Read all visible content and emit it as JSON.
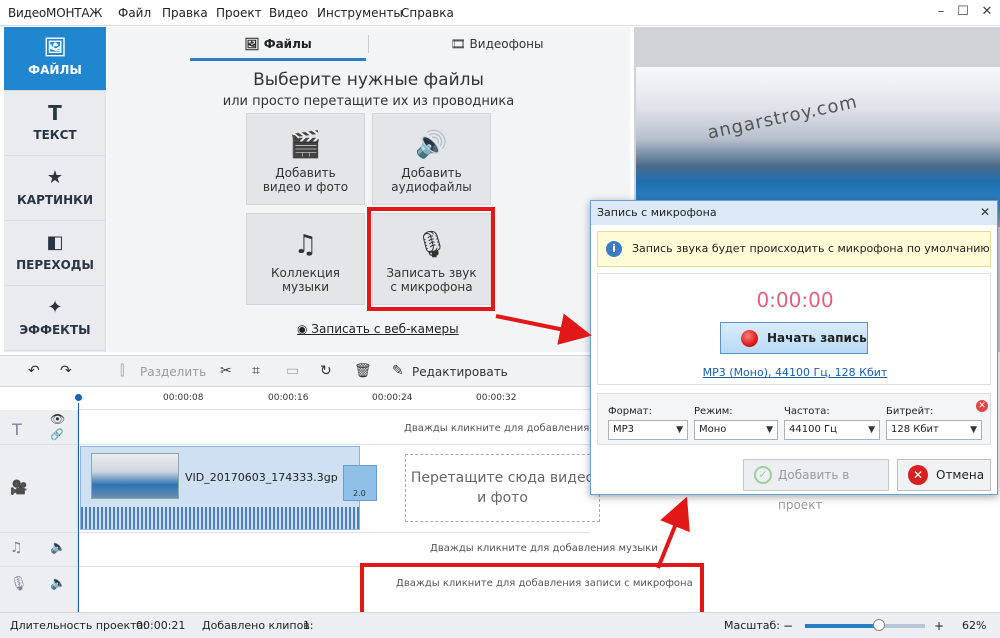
{
  "app": {
    "title": "ВидеоМОНТАЖ"
  },
  "menu": [
    "Файл",
    "Правка",
    "Проект",
    "Видео",
    "Инструменты",
    "Справка"
  ],
  "sidebar": {
    "items": [
      {
        "label": "ФАЙЛЫ",
        "icon": "image-icon",
        "active": true
      },
      {
        "label": "ТЕКСТ",
        "icon": "text-icon"
      },
      {
        "label": "КАРТИНКИ",
        "icon": "star-icon"
      },
      {
        "label": "ПЕРЕХОДЫ",
        "icon": "transitions-icon"
      },
      {
        "label": "ЭФФЕКТЫ",
        "icon": "magic-wand-icon"
      }
    ]
  },
  "files": {
    "tabs": [
      {
        "label": "Файлы"
      },
      {
        "label": "Видеофоны"
      }
    ],
    "heading": "Выберите нужные файлы",
    "subheading": "или просто перетащите их из проводника",
    "tiles": [
      {
        "line1": "Добавить",
        "line2": "видео и фото",
        "icon": "film-camera-icon"
      },
      {
        "line1": "Добавить",
        "line2": "аудиофайлы",
        "icon": "audio-file-icon"
      },
      {
        "line1": "Коллекция",
        "line2": "музыки",
        "icon": "music-notes-icon"
      },
      {
        "line1": "Записать звук",
        "line2": "с микрофона",
        "icon": "microphone-icon"
      }
    ],
    "webcam_link": "Записать с веб-камеры"
  },
  "preview": {
    "watermark": "angarstroy.com"
  },
  "toolbar": {
    "split": "Разделить",
    "edit": "Редактировать"
  },
  "timeline": {
    "ticks": [
      "00:00:08",
      "00:00:16",
      "00:00:24",
      "00:00:32"
    ],
    "text_hint": "Дважды кликните для добавления т",
    "clip_name": "VID_20170603_174333.3gp",
    "transition_label": "2.0",
    "drop_zone": "Перетащите сюда видео и фото",
    "music_hint": "Дважды кликните для добавления музыки",
    "mic_hint": "Дважды кликните для добавления записи с микрофона"
  },
  "status": {
    "duration_label": "Длительность проекта:",
    "duration": "00:00:21",
    "clips_label": "Добавлено клипов:",
    "clips": "1",
    "zoom_label": "Масштаб:",
    "zoom_minus": "−",
    "zoom_plus": "+",
    "zoom": "62%",
    "zoom_level": 0.62
  },
  "dialog": {
    "title": "Запись с микрофона",
    "info": "Запись звука будет происходить с микрофона по умолчанию",
    "timer": "0:00:00",
    "record_button": "Начать запись",
    "format_link": "MP3 (Моно), 44100 Гц, 128 Кбит",
    "settings": [
      {
        "label": "Формат:",
        "value": "MP3"
      },
      {
        "label": "Режим:",
        "value": "Моно"
      },
      {
        "label": "Частота:",
        "value": "44100 Гц"
      },
      {
        "label": "Битрейт:",
        "value": "128 Кбит"
      }
    ],
    "add_button": "Добавить в проект",
    "cancel_button": "Отмена"
  },
  "colors": {
    "accent": "#1f86cf",
    "annotation": "#e21818",
    "timer": "#e0627a"
  }
}
